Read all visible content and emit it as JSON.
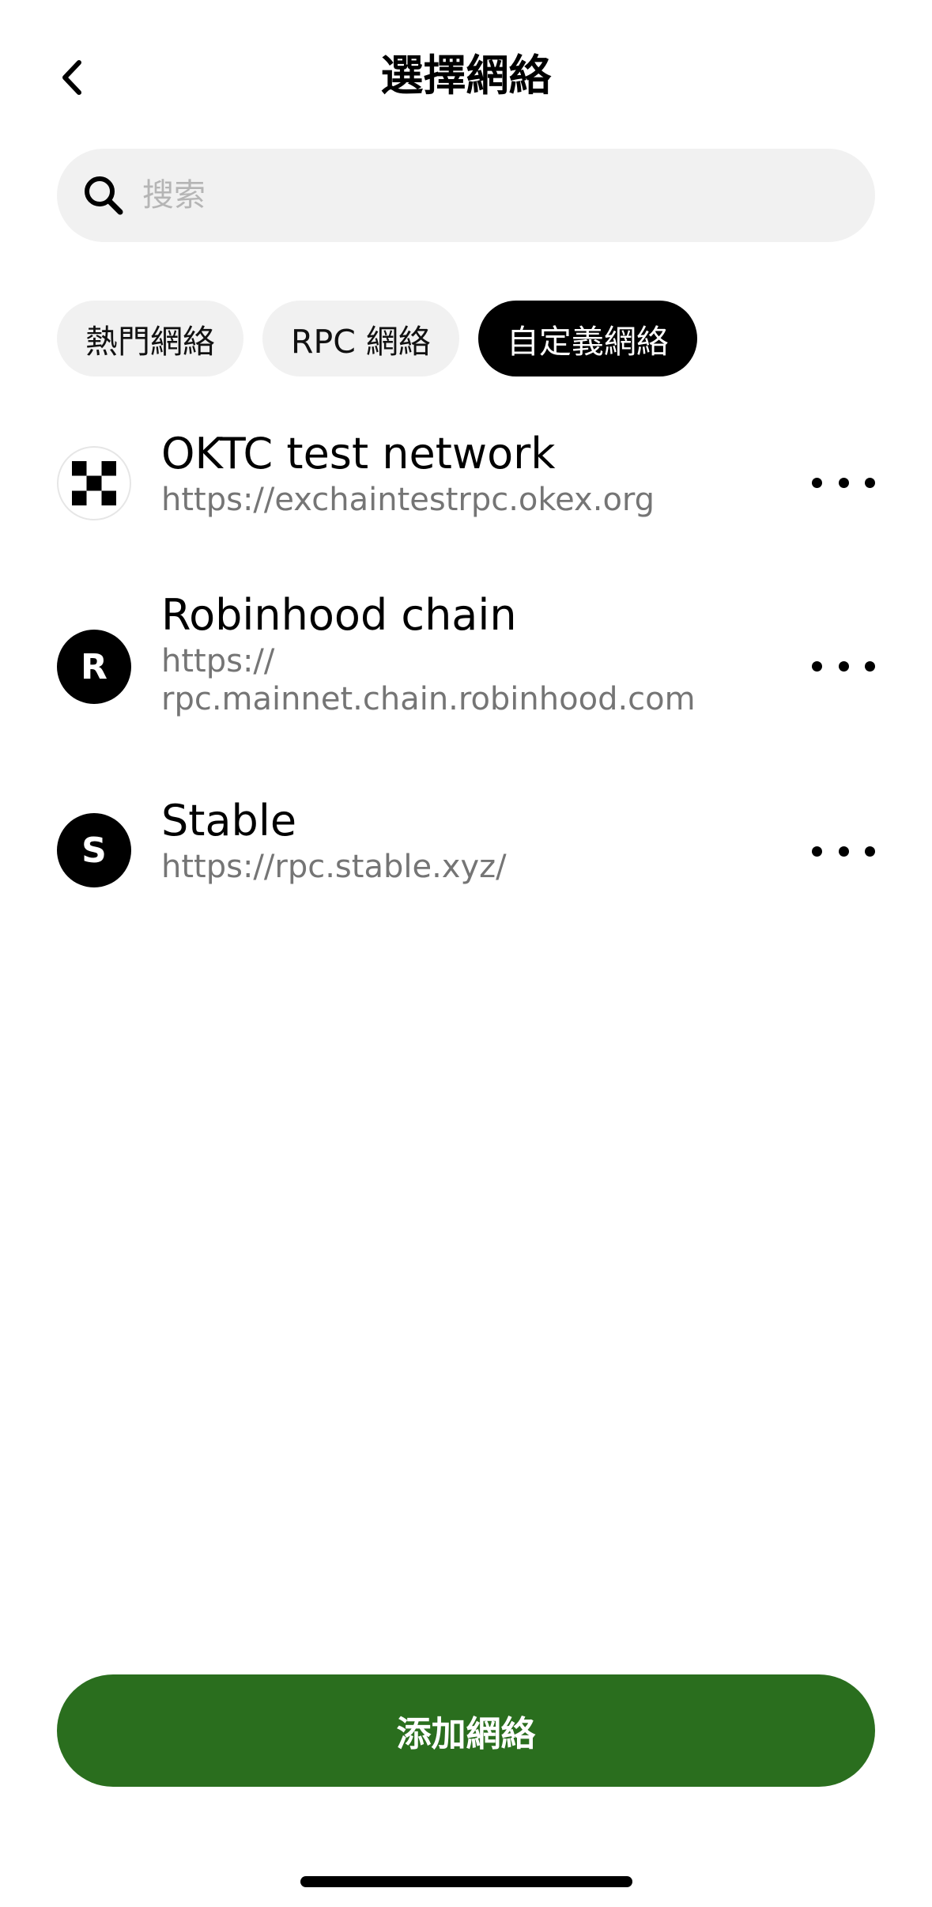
{
  "header": {
    "title": "選擇網絡"
  },
  "search": {
    "placeholder": "搜索",
    "value": ""
  },
  "tabs": [
    {
      "label": "熱門網絡",
      "active": false
    },
    {
      "label": "RPC 網絡",
      "active": false
    },
    {
      "label": "自定義網絡",
      "active": true
    }
  ],
  "networks": [
    {
      "name": "OKTC test network",
      "url": "https://exchaintestrpc.okex.org",
      "icon": "okx-checker-icon"
    },
    {
      "name": "Robinhood chain",
      "url": "https://\nrpc.mainnet.chain.robinhood.com",
      "icon": "letter-r-icon",
      "icon_letter": "R"
    },
    {
      "name": "Stable",
      "url": "https://rpc.stable.xyz/",
      "icon": "letter-s-icon",
      "icon_letter": "S"
    }
  ],
  "footer": {
    "add_label": "添加網絡"
  },
  "colors": {
    "primary_button": "#2a6e1e",
    "active_tab": "#000000",
    "inactive_tab": "#f1f1f1",
    "secondary_text": "#757575"
  }
}
